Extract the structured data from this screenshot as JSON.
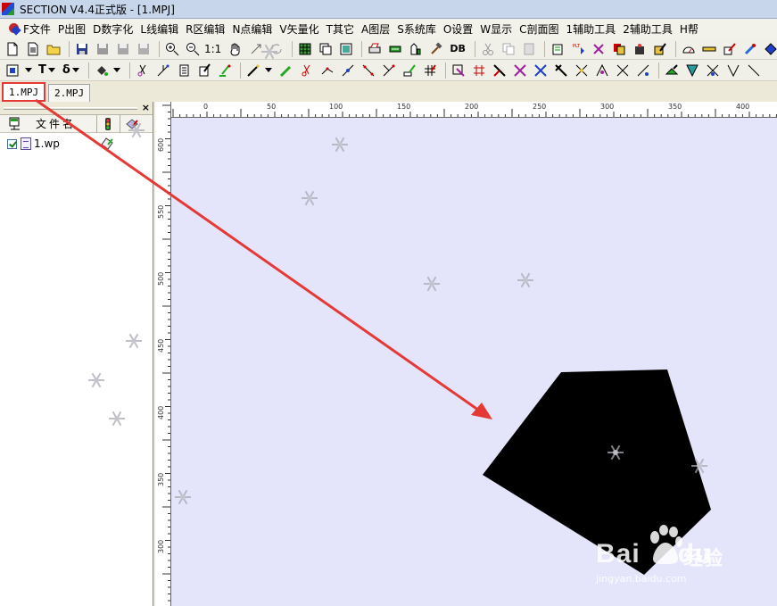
{
  "window": {
    "title": "SECTION V4.4正式版 - [1.MPJ]"
  },
  "menu": [
    "F文件",
    "P出图",
    "D数字化",
    "L线编辑",
    "R区编辑",
    "N点编辑",
    "V矢量化",
    "T其它",
    "A图层",
    "S系统库",
    "O设置",
    "W显示",
    "C剖面图",
    "1辅助工具",
    "2辅助工具",
    "H帮"
  ],
  "toolbar1": {
    "zoom_label": "1:1",
    "db_label": "DB"
  },
  "toolbar2": {
    "text_label": "T",
    "delta_label": "δ"
  },
  "tabs": [
    "1.MPJ",
    "2.MPJ"
  ],
  "left_panel": {
    "column_name": "文件名",
    "file": "1.wp"
  },
  "ruler_h": [
    "0",
    "50",
    "100",
    "150",
    "200",
    "250",
    "300",
    "350",
    "400"
  ],
  "ruler_v": [
    "600",
    "550",
    "500",
    "450",
    "400",
    "350",
    "300"
  ],
  "watermark": {
    "brand": "Bai",
    "brand2": "du",
    "cn": "经验",
    "url": "jingyan.baidu.com"
  },
  "colors": {
    "canvas_bg": "#e4e4fa",
    "polygon": "#000000",
    "annotation": "#e53935"
  }
}
